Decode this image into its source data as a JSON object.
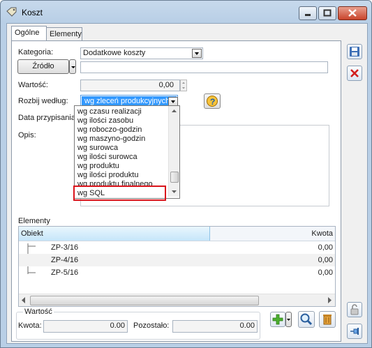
{
  "window": {
    "title": "Koszt"
  },
  "tabs": [
    {
      "label": "Ogólne"
    },
    {
      "label": "Elementy"
    }
  ],
  "form": {
    "kategoria_label": "Kategoria:",
    "kategoria_value": "Dodatkowe koszty",
    "zrodlo_button": "Źródło",
    "zrodlo_value": "",
    "wartosc_label": "Wartość:",
    "wartosc_value": "0,00",
    "rozbij_label": "Rozbij według:",
    "rozbij_value": "wg zleceń produkcyjnych",
    "data_label": "Data przypisania:",
    "opis_label": "Opis:"
  },
  "dropdown": {
    "items": [
      "wg czasu realizacji",
      "wg ilości zasobu",
      "wg roboczo-godzin",
      "wg maszyno-godzin",
      "wg surowca",
      "wg ilości surowca",
      "wg produktu",
      "wg ilości produktu",
      "wg produktu finalnego",
      "wg SQL"
    ],
    "highlighted": "wg SQL",
    "highlight_color": "#d9131b"
  },
  "elementy": {
    "group_label": "Elementy",
    "columns": [
      "Obiekt",
      "Kwota"
    ],
    "rows": [
      {
        "obiekt": "ZP-3/16",
        "kwota": "0,00"
      },
      {
        "obiekt": "ZP-4/16",
        "kwota": "0,00"
      },
      {
        "obiekt": "ZP-5/16",
        "kwota": "0,00"
      }
    ]
  },
  "summary": {
    "group_label": "Wartość",
    "kwota_label": "Kwota:",
    "kwota_value": "0.00",
    "pozostalo_label": "Pozostało:",
    "pozostalo_value": "0.00"
  },
  "icons": {
    "save": "floppy-disk-icon",
    "delete": "red-x-icon",
    "lock": "padlock-icon",
    "pin": "pushpin-icon",
    "add": "green-plus-icon",
    "search": "magnifier-icon",
    "trash": "trash-can-icon",
    "help": "help-question-icon"
  },
  "colors": {
    "accent": "#3399ff",
    "chrome": "#b9cfe6"
  }
}
